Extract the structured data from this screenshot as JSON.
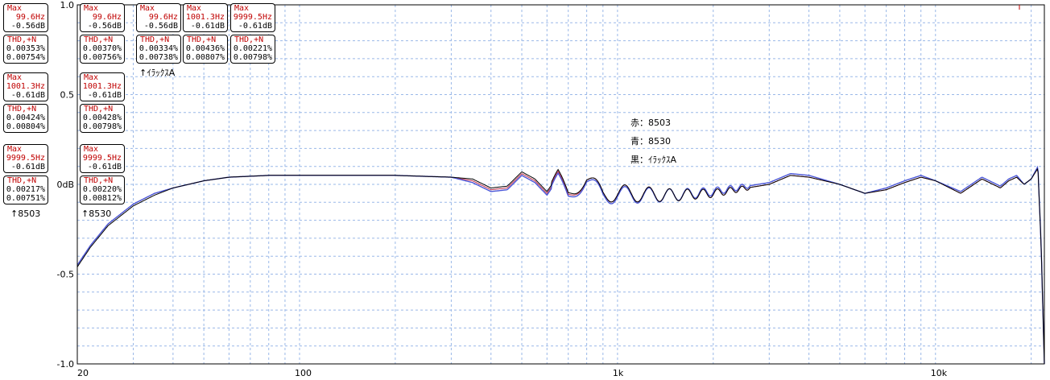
{
  "chart_data": {
    "type": "line",
    "xscale": "log",
    "xlim": [
      20,
      22000
    ],
    "ylim": [
      -1.0,
      1.0
    ],
    "grid": true,
    "x_ticks": [
      {
        "value": 20,
        "label": "20"
      },
      {
        "value": 100,
        "label": "100"
      },
      {
        "value": 1000,
        "label": "1k"
      },
      {
        "value": 10000,
        "label": "10k"
      }
    ],
    "y_ticks": [
      {
        "value": 1.0,
        "label": "1.0"
      },
      {
        "value": 0.5,
        "label": "0.5"
      },
      {
        "value": 0.0,
        "label": "0dB"
      },
      {
        "value": -0.5,
        "label": "-0.5"
      },
      {
        "value": -1.0,
        "label": "-1.0"
      }
    ],
    "legend": [
      "赤：8503",
      "青：8530",
      "黒：ｲﾗｯｸｽA"
    ],
    "series": [
      {
        "name": "8503",
        "color": "#c0304a",
        "x": [
          20,
          22,
          25,
          30,
          35,
          40,
          50,
          60,
          80,
          100,
          150,
          200,
          300,
          350,
          400,
          450,
          500,
          550,
          600,
          650,
          700,
          800,
          900,
          1000,
          1500,
          2000,
          3000,
          3500,
          4000,
          5000,
          6000,
          7000,
          8000,
          9000,
          10000,
          12000,
          14000,
          16000,
          17000,
          18000,
          19000,
          20000,
          21000,
          21500,
          22000
        ],
        "y": [
          -0.45,
          -0.34,
          -0.22,
          -0.11,
          -0.05,
          -0.02,
          0.02,
          0.04,
          0.05,
          0.05,
          0.05,
          0.05,
          0.04,
          0.02,
          -0.03,
          -0.02,
          0.06,
          0.02,
          -0.05,
          0.04,
          -0.06,
          0.03,
          -0.05,
          -0.05,
          -0.06,
          -0.05,
          0.0,
          0.05,
          0.04,
          0.0,
          -0.05,
          -0.03,
          0.01,
          0.04,
          0.02,
          -0.05,
          0.03,
          -0.02,
          0.02,
          0.04,
          0.0,
          0.03,
          0.09,
          -0.35,
          -1.0
        ]
      },
      {
        "name": "8530",
        "color": "#4a56d8",
        "x": [
          20,
          22,
          25,
          30,
          35,
          40,
          50,
          60,
          80,
          100,
          150,
          200,
          300,
          350,
          400,
          450,
          500,
          550,
          600,
          650,
          700,
          800,
          900,
          1000,
          1500,
          2000,
          3000,
          3500,
          4000,
          5000,
          6000,
          7000,
          8000,
          9000,
          10000,
          12000,
          14000,
          16000,
          17000,
          18000,
          19000,
          20000,
          21000,
          21500,
          22000
        ],
        "y": [
          -0.45,
          -0.34,
          -0.22,
          -0.11,
          -0.05,
          -0.02,
          0.02,
          0.04,
          0.05,
          0.05,
          0.05,
          0.05,
          0.04,
          0.01,
          -0.04,
          -0.03,
          0.05,
          0.01,
          -0.06,
          0.03,
          -0.07,
          0.02,
          -0.06,
          -0.06,
          -0.06,
          -0.04,
          0.01,
          0.06,
          0.05,
          0.0,
          -0.05,
          -0.02,
          0.02,
          0.05,
          0.02,
          -0.04,
          0.04,
          -0.01,
          0.03,
          0.05,
          0.0,
          0.03,
          0.1,
          -0.35,
          -1.0
        ]
      },
      {
        "name": "ｲﾗｯｸｽA",
        "color": "#000000",
        "x": [
          20,
          22,
          25,
          30,
          35,
          40,
          50,
          60,
          80,
          100,
          150,
          200,
          300,
          350,
          400,
          450,
          500,
          550,
          600,
          650,
          700,
          800,
          900,
          1000,
          1500,
          2000,
          3000,
          3500,
          4000,
          5000,
          6000,
          7000,
          8000,
          9000,
          10000,
          12000,
          14000,
          16000,
          17000,
          18000,
          19000,
          20000,
          21000,
          21500,
          22000
        ],
        "y": [
          -0.46,
          -0.35,
          -0.23,
          -0.12,
          -0.06,
          -0.02,
          0.02,
          0.04,
          0.05,
          0.05,
          0.05,
          0.05,
          0.04,
          0.03,
          -0.02,
          -0.01,
          0.07,
          0.03,
          -0.04,
          0.05,
          -0.05,
          0.03,
          -0.05,
          -0.05,
          -0.06,
          -0.05,
          0.0,
          0.05,
          0.04,
          0.0,
          -0.05,
          -0.03,
          0.01,
          0.04,
          0.02,
          -0.05,
          0.03,
          -0.02,
          0.02,
          0.04,
          0.0,
          0.03,
          0.09,
          -0.35,
          -1.0
        ]
      }
    ]
  },
  "readouts": {
    "col1": {
      "max1": {
        "hdr": "Max",
        "freq": "99.6Hz",
        "db": "-0.56dB"
      },
      "thd1": {
        "hdr": "THD,+N",
        "a": "0.00353%",
        "b": "0.00754%"
      },
      "max2": {
        "hdr": "Max",
        "freq": "1001.3Hz",
        "db": "-0.61dB"
      },
      "thd2": {
        "hdr": "THD,+N",
        "a": "0.00424%",
        "b": "0.00804%"
      },
      "max3": {
        "hdr": "Max",
        "freq": "9999.5Hz",
        "db": "-0.61dB"
      },
      "thd3": {
        "hdr": "THD,+N",
        "a": "0.00217%",
        "b": "0.00751%"
      },
      "arrow_label": "↑8503"
    },
    "col2": {
      "max1": {
        "hdr": "Max",
        "freq": "99.6Hz",
        "db": "-0.56dB"
      },
      "thd1": {
        "hdr": "THD,+N",
        "a": "0.00370%",
        "b": "0.00756%"
      },
      "max2": {
        "hdr": "Max",
        "freq": "1001.3Hz",
        "db": "-0.61dB"
      },
      "thd2": {
        "hdr": "THD,+N",
        "a": "0.00428%",
        "b": "0.00798%"
      },
      "max3": {
        "hdr": "Max",
        "freq": "9999.5Hz",
        "db": "-0.61dB"
      },
      "thd3": {
        "hdr": "THD,+N",
        "a": "0.00220%",
        "b": "0.00812%"
      },
      "arrow_label": "↑8530"
    },
    "col3": {
      "max1": {
        "hdr": "Max",
        "freq": "99.6Hz",
        "db": "-0.56dB"
      },
      "thd1": {
        "hdr": "THD,+N",
        "a": "0.00334%",
        "b": "0.00738%"
      },
      "arrow_label": "↑ｲﾗｯｸｽA"
    },
    "col4": {
      "max1": {
        "hdr": "Max",
        "freq": "1001.3Hz",
        "db": "-0.61dB"
      },
      "thd1": {
        "hdr": "THD,+N",
        "a": "0.00436%",
        "b": "0.00807%"
      }
    },
    "col5": {
      "max1": {
        "hdr": "Max",
        "freq": "9999.5Hz",
        "db": "-0.61dB"
      },
      "thd1": {
        "hdr": "THD,+N",
        "a": "0.00221%",
        "b": "0.00798%"
      }
    }
  },
  "colors": {
    "grid": "#9ab8e8",
    "frame": "#000000",
    "max_text": "#c00000"
  }
}
